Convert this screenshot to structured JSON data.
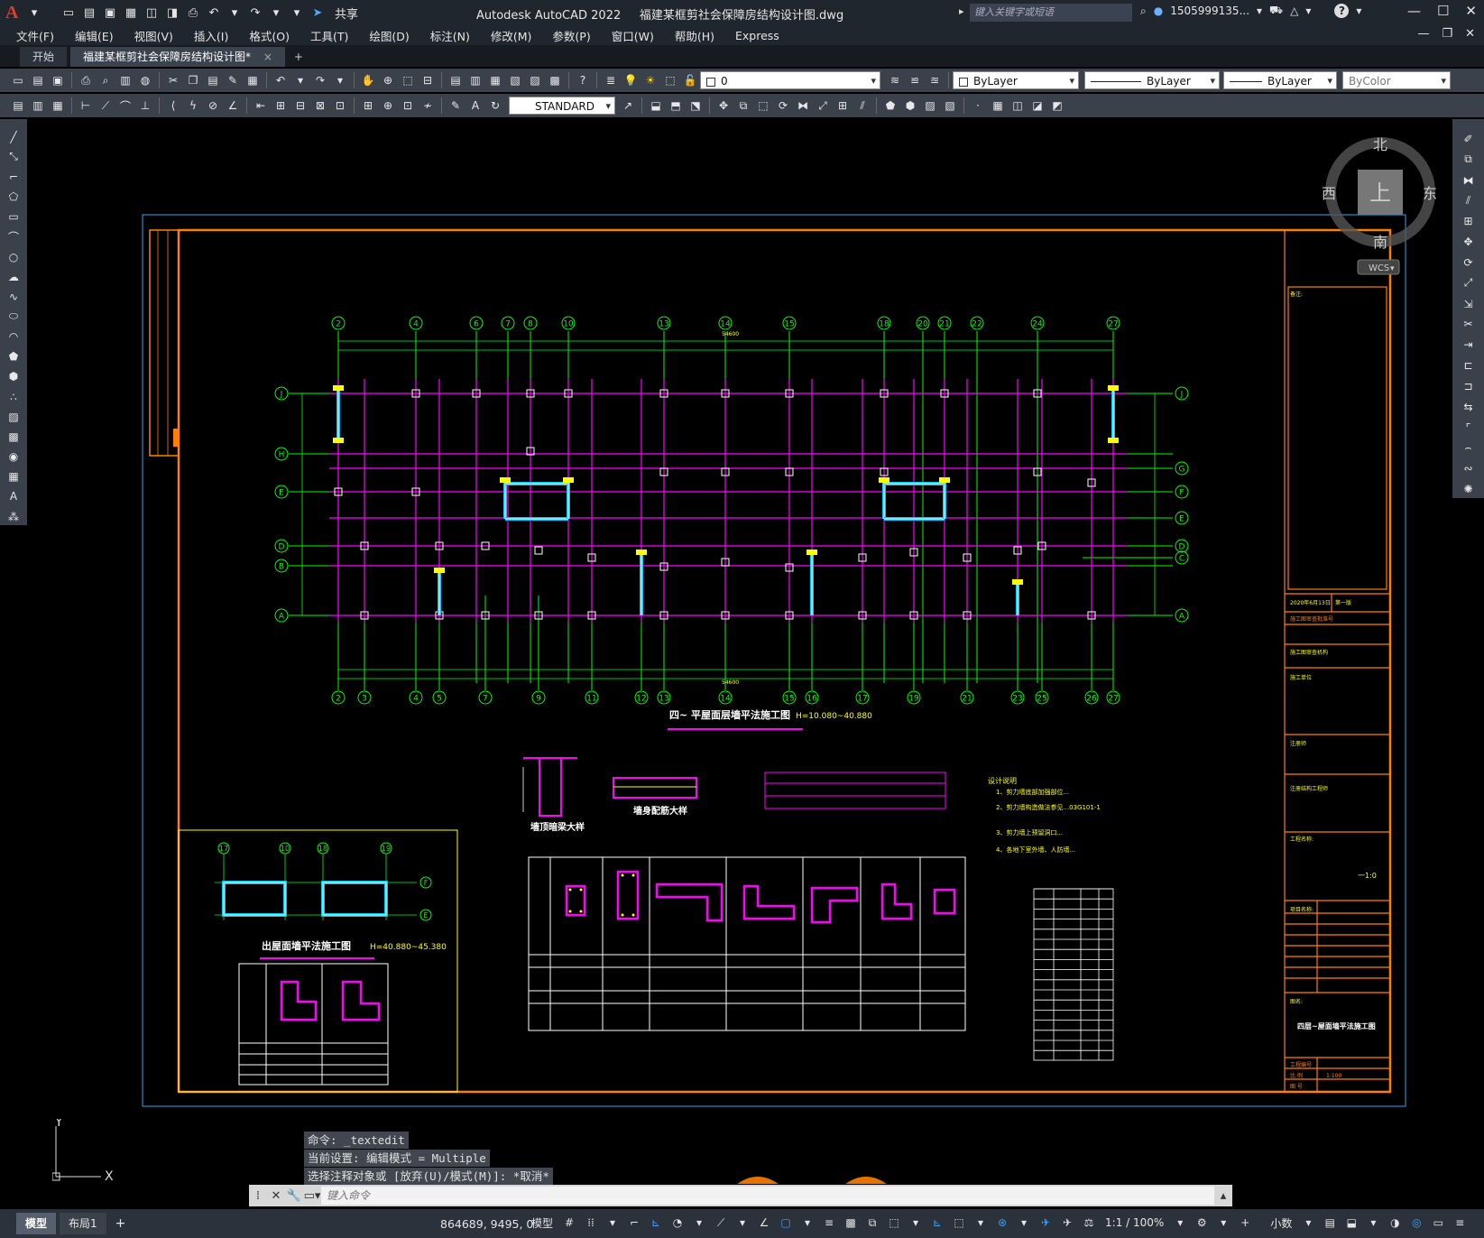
{
  "app": {
    "logo": "A",
    "title": "Autodesk AutoCAD 2022",
    "file": "福建某框剪社会保障房结构设计图.dwg",
    "share_label": "共享",
    "search_placeholder": "键入关键字或短语",
    "user": "1505999135...",
    "help": "?"
  },
  "menu": {
    "items": [
      "文件(F)",
      "编辑(E)",
      "视图(V)",
      "插入(I)",
      "格式(O)",
      "工具(T)",
      "绘图(D)",
      "标注(N)",
      "修改(M)",
      "参数(P)",
      "窗口(W)",
      "帮助(H)",
      "Express"
    ]
  },
  "tabs": {
    "start": "开始",
    "doc": "福建某框剪社会保障房结构设计图*",
    "close": "×",
    "add": "+"
  },
  "toolbar": {
    "layer_value": "0",
    "color_value": "ByLayer",
    "linetype_value": "ByLayer",
    "lineweight_value": "ByLayer",
    "plotstyle_value": "ByColor",
    "textstyle_value": "STANDARD"
  },
  "viewcube": {
    "north": "北",
    "south": "南",
    "east": "东",
    "west": "西",
    "top": "上",
    "wcs": "WCS"
  },
  "drawing": {
    "main_plan_title": "四~ 平屋面层墙平法施工图",
    "main_plan_elev": "H=10.080~40.880",
    "roof_plan_title": "出屋面墙平法施工图",
    "roof_plan_elev": "H=40.880~45.380",
    "detail_beam": "墙顶暗梁大样",
    "detail_wall": "墙身配筋大样",
    "design_notes_title": "设计说明",
    "design_notes": [
      "1、剪力墙底部加强部位...",
      "2、剪力墙构造做法参见...03G101-1",
      "3、剪力墙上预留洞口...",
      "4、各地下室外墙、人防墙..."
    ],
    "title_block_name": "四层~屋面墙平法施工图",
    "title_block_scale": "1:100",
    "title_block_sheet": "一1:0",
    "top_axes": [
      "2",
      "4",
      "6",
      "7",
      "8",
      "10",
      "13",
      "14",
      "15",
      "18",
      "20",
      "21",
      "22",
      "24",
      "27"
    ],
    "bottom_axes": [
      "2",
      "3",
      "4",
      "5",
      "7",
      "9",
      "11",
      "12",
      "13",
      "14",
      "15",
      "16",
      "17",
      "19",
      "21",
      "23",
      "25",
      "26",
      "27"
    ],
    "left_axes": [
      "J",
      "H",
      "E",
      "D",
      "B",
      "A"
    ],
    "right_axes": [
      "J",
      "G",
      "F",
      "E",
      "D",
      "C",
      "A"
    ],
    "overall_dim": "54600",
    "roof_axes": [
      "17",
      "10",
      "18",
      "19"
    ]
  },
  "command": {
    "history": [
      "命令: _textedit",
      "当前设置: 编辑模式 = Multiple",
      "选择注释对象或 [放弃(U)/模式(M)]: *取消*"
    ],
    "placeholder": "键入命令"
  },
  "ucs": {
    "x": "X",
    "y": "Y"
  },
  "status": {
    "tab_model": "模型",
    "tab_layout": "布局1",
    "add": "+",
    "coords": "864689, 9495, 0",
    "space": "模型",
    "scale": "1:1 / 100%",
    "units": "小数"
  },
  "colors": {
    "magenta": "#ff00ff",
    "green": "#00ff00",
    "orange": "#ff8000",
    "yellow": "#ffff00",
    "cyan": "#00c8ff",
    "white": "#ffffff",
    "frame_blue": "#1e90c8"
  }
}
